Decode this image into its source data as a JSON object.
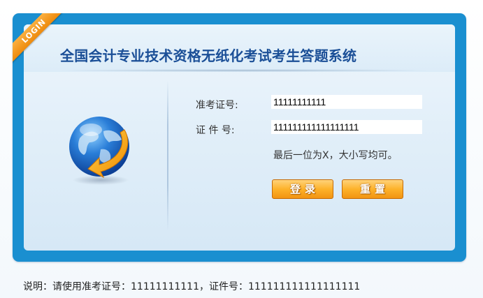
{
  "header": {
    "ribbon_label": "LOGIN",
    "title": "全国会计专业技术资格无纸化考试考生答题系统"
  },
  "form": {
    "exam_id_label": "准考证号:",
    "exam_id_value": "11111111111",
    "cert_id_label": "证 件 号:",
    "cert_id_value": "111111111111111111",
    "hint": "最后一位为X，大小写均可。",
    "login_button": "登录",
    "reset_button": "重置"
  },
  "footer": {
    "note": "说明：请使用准考证号：11111111111，证件号：111111111111111111"
  },
  "icons": {
    "globe": "globe-icon"
  },
  "colors": {
    "frame": "#1a8fd0",
    "title": "#1b4f97",
    "button": "#fdb22a",
    "ribbon": "#f59a1e"
  }
}
